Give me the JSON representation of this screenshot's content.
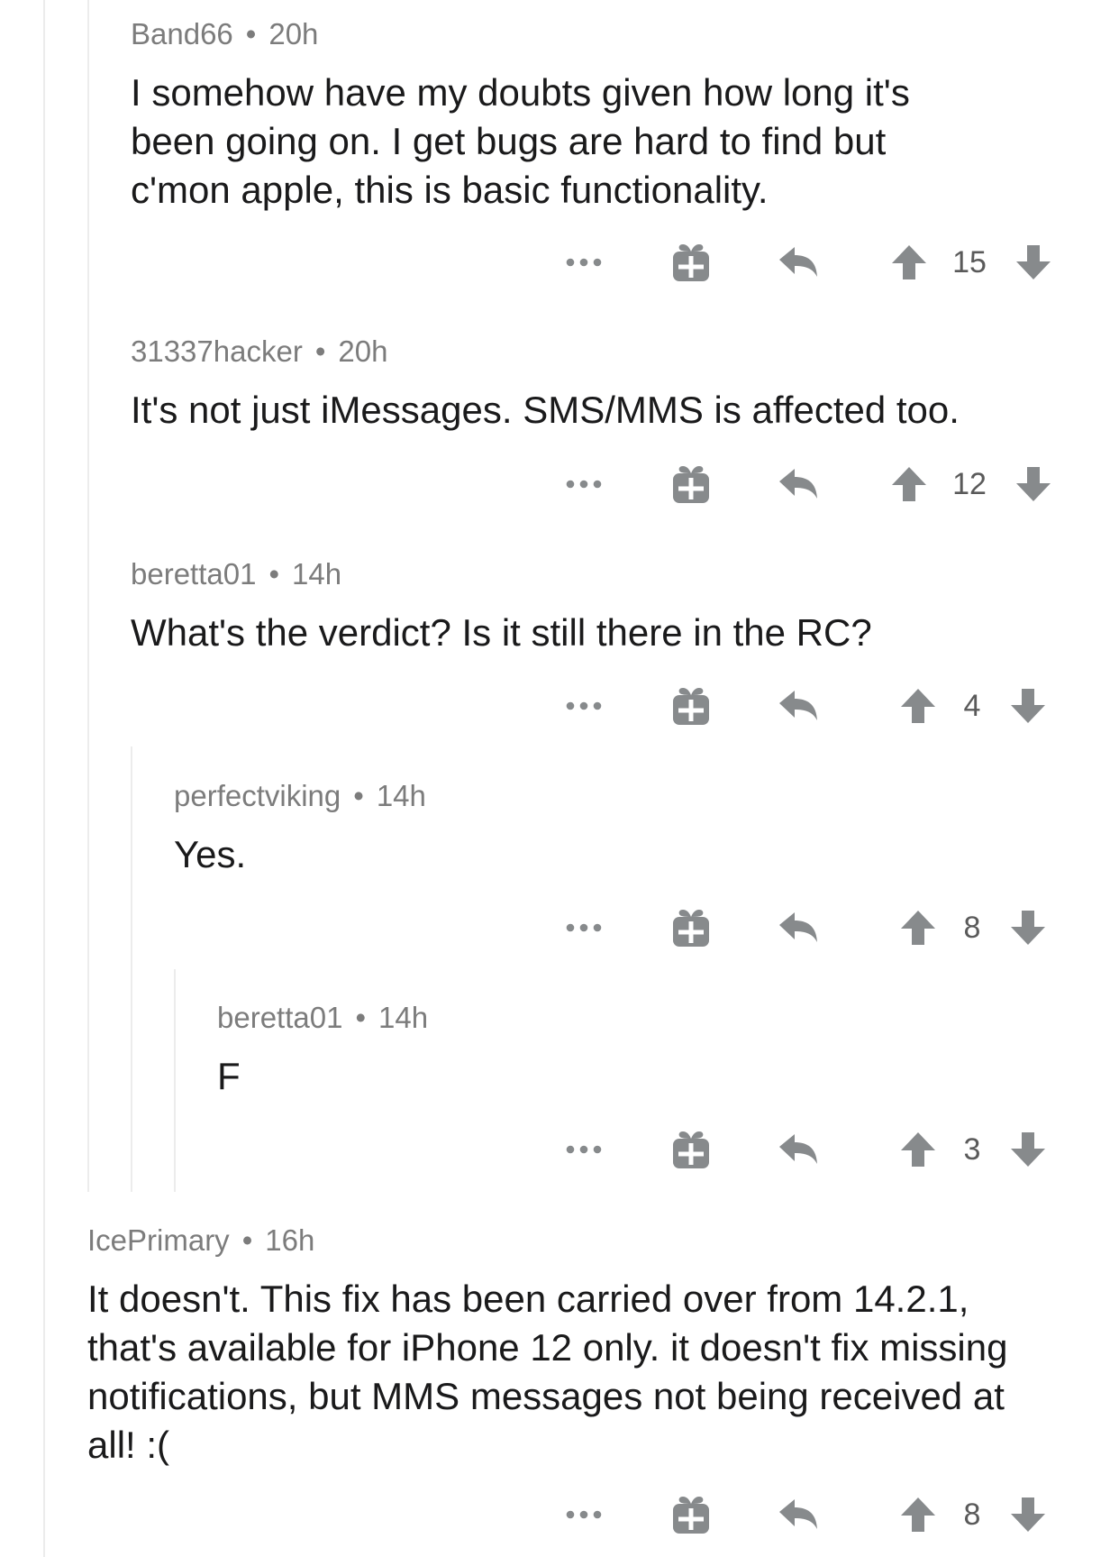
{
  "thread": {
    "separator": "•",
    "comments": [
      {
        "author": "Band66",
        "age": "20h",
        "text": "I somehow have my doubts given how long it's been going on. I get bugs are hard to find but c'mon apple, this is basic functionality.",
        "score": "15"
      },
      {
        "author": "31337hacker",
        "age": "20h",
        "text": "It's not just iMessages. SMS/MMS is affected too.",
        "score": "12"
      },
      {
        "author": "beretta01",
        "age": "14h",
        "text": "What's the verdict? Is it still there in the RC?",
        "score": "4"
      },
      {
        "author": "perfectviking",
        "age": "14h",
        "text": "Yes.",
        "score": "8"
      },
      {
        "author": "beretta01",
        "age": "14h",
        "text": "F",
        "score": "3"
      },
      {
        "author": "IcePrimary",
        "age": "16h",
        "text": "It doesn't. This fix has been carried over from 14.2.1, that's available for iPhone 12 only. it doesn't fix missing notifications, but MMS messages not being received at all! :(",
        "score": "8"
      }
    ]
  },
  "icons": {
    "more": "more-options-icon",
    "award": "gift-award-icon",
    "reply": "reply-arrow-icon",
    "upvote": "upvote-arrow-icon",
    "downvote": "downvote-arrow-icon"
  },
  "colors": {
    "meta_text": "#7c7c7c",
    "body_text": "#1a1a1b",
    "icon_gray": "#878a8c",
    "thread_line": "#ececec"
  }
}
